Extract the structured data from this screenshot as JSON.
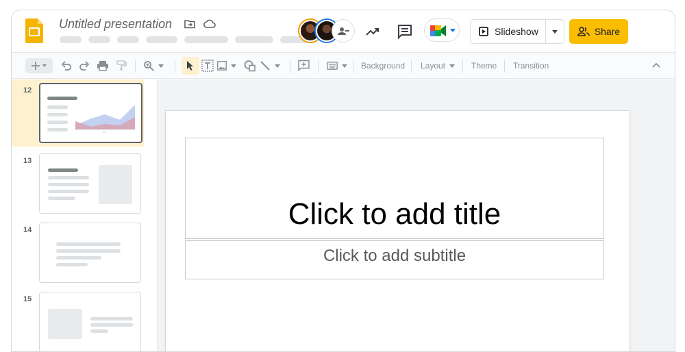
{
  "app": {
    "title": "Untitled presentation"
  },
  "header": {
    "slideshow_label": "Slideshow",
    "share_label": "Share"
  },
  "toolbar": {
    "background_label": "Background",
    "layout_label": "Layout",
    "theme_label": "Theme",
    "transition_label": "Transition"
  },
  "filmstrip": {
    "slides": [
      {
        "number": "12",
        "selected": true,
        "layout": "chart"
      },
      {
        "number": "13",
        "selected": false,
        "layout": "text-image"
      },
      {
        "number": "14",
        "selected": false,
        "layout": "text-center"
      },
      {
        "number": "15",
        "selected": false,
        "layout": "image-text"
      }
    ]
  },
  "slide": {
    "title_placeholder": "Click to add title",
    "subtitle_placeholder": "Click to add subtitle"
  },
  "colors": {
    "accent_yellow": "#fbbc04",
    "selected_slide_bg": "#fdf1cf",
    "logo_yellow": "#f4b400"
  },
  "icons": [
    "move-to-folder-icon",
    "cloud-status-icon",
    "activity-trend-icon",
    "comment-icon",
    "meet-video-icon",
    "present-icon",
    "people-icon",
    "new-slide-icon",
    "undo-icon",
    "redo-icon",
    "print-icon",
    "paint-format-icon",
    "zoom-icon",
    "select-cursor-icon",
    "text-box-icon",
    "image-icon",
    "shape-icon",
    "line-icon",
    "comment-add-icon",
    "keyboard-input-icon",
    "collapse-chevron-icon"
  ]
}
